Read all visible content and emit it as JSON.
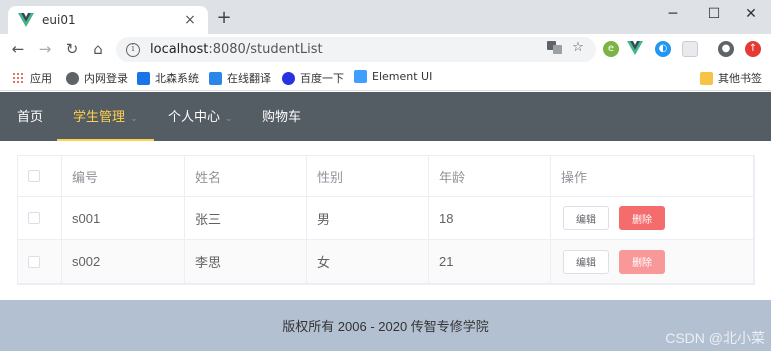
{
  "browser": {
    "tab_title": "eui01",
    "tab_close": "×",
    "new_tab": "+",
    "url_host": "localhost",
    "url_rest": ":8080/studentList",
    "window_controls": {
      "minimize": "─",
      "maximize": "☐",
      "close": "✕"
    },
    "nav": {
      "back": "←",
      "forward": "→",
      "reload": "↻",
      "home": "⌂"
    },
    "bookmarks": [
      {
        "label": "应用",
        "icon": "apps-grid-icon",
        "color": "#e34133"
      },
      {
        "label": "内网登录",
        "icon": "globe-icon",
        "color": "#5f6368"
      },
      {
        "label": "北森系统",
        "icon": "beisen-icon",
        "color": "#1a73e8"
      },
      {
        "label": "在线翻译",
        "icon": "translate-icon",
        "color": "#2a86e8"
      },
      {
        "label": "百度一下",
        "icon": "baidu-paw-icon",
        "color": "#2932e1"
      },
      {
        "label": "Element UI",
        "icon": "element-ui-icon",
        "color": "#409eff"
      }
    ],
    "other_bookmarks": "其他书签"
  },
  "nav": {
    "items": [
      {
        "label": "首页",
        "active": false,
        "has_caret": false
      },
      {
        "label": "学生管理",
        "active": true,
        "has_caret": true
      },
      {
        "label": "个人中心",
        "active": false,
        "has_caret": true
      },
      {
        "label": "购物车",
        "active": false,
        "has_caret": false
      }
    ],
    "caret": "⌄",
    "bg_color": "#545c64",
    "active_color": "#ffd04b"
  },
  "table": {
    "headers": {
      "id": "编号",
      "name": "姓名",
      "gender": "性别",
      "age": "年龄",
      "actions": "操作"
    },
    "rows": [
      {
        "id": "s001",
        "name": "张三",
        "gender": "男",
        "age": "18"
      },
      {
        "id": "s002",
        "name": "李思",
        "gender": "女",
        "age": "21"
      }
    ],
    "edit_label": "编辑",
    "delete_label": "删除",
    "danger_color": "#f56c6c"
  },
  "footer": {
    "copyright": "版权所有 2006 - 2020 传智专修学院",
    "bg_color": "#b3c0d1"
  },
  "watermark": "CSDN @北小菜"
}
